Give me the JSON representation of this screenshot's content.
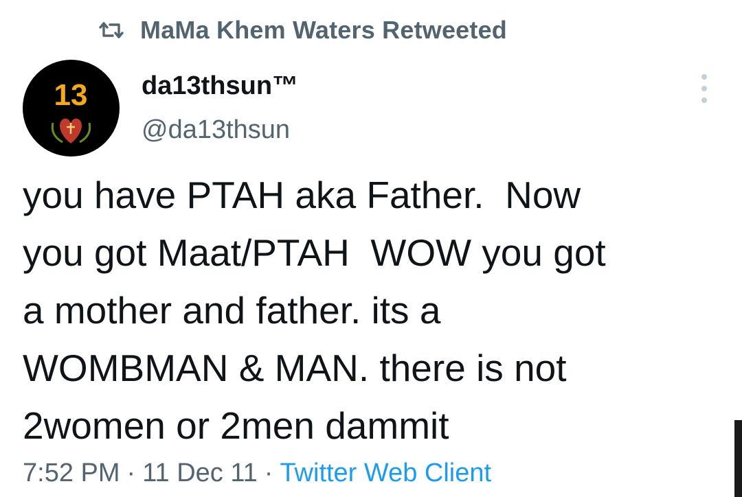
{
  "retweet": {
    "icon": "retweet-icon",
    "label": "MaMa Khem Waters Retweeted"
  },
  "author": {
    "avatar_text": "13",
    "display_name": "da13thsun™",
    "handle": "@da13thsun"
  },
  "tweet": {
    "lines": [
      "you have PTAH aka Father.  Now",
      "you got Maat/PTAH  WOW you got",
      "a mother and father. its a",
      "WOMBMAN & MAN. there is not",
      "2women or 2men dammit"
    ]
  },
  "meta": {
    "time": "7:52 PM",
    "separator": "·",
    "date": "11 Dec 11",
    "client": "Twitter Web Client"
  },
  "colors": {
    "text": "#0f1419",
    "secondary": "#536471",
    "link": "#1d9bf0",
    "avatar_bg": "#000000",
    "avatar_number": "#f2a91d",
    "heart": "#c0392b"
  }
}
